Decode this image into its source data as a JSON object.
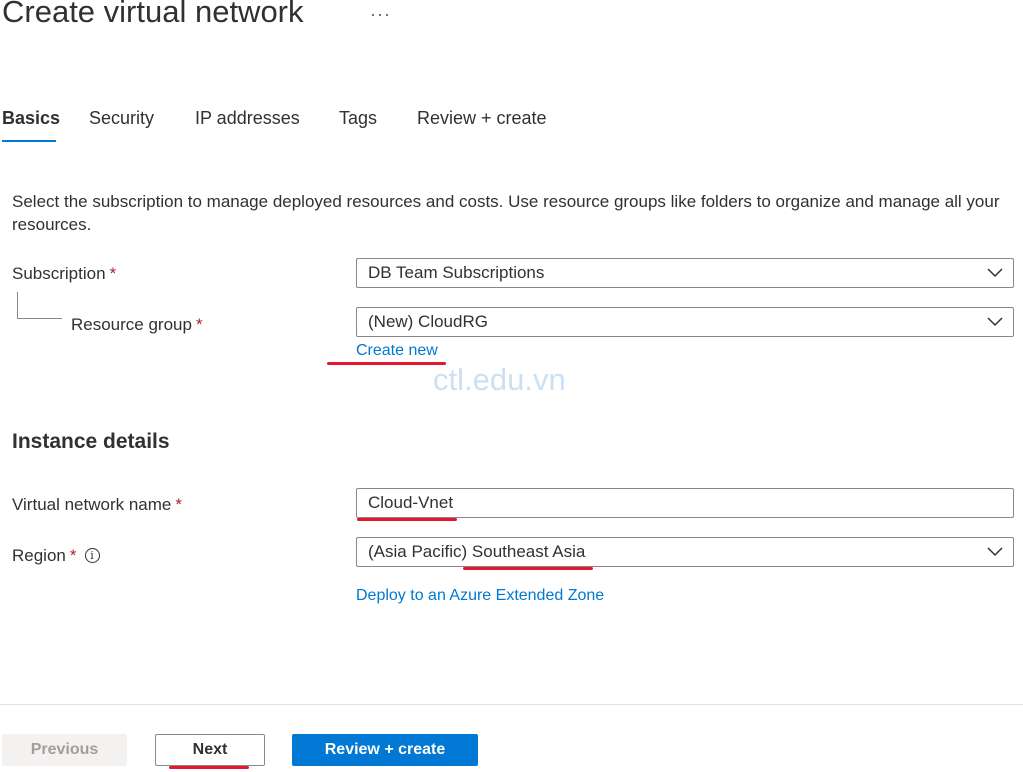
{
  "header": {
    "title": "Create virtual network",
    "more_label": "···"
  },
  "tabs": [
    {
      "label": "Basics",
      "active": true
    },
    {
      "label": "Security",
      "active": false
    },
    {
      "label": "IP addresses",
      "active": false
    },
    {
      "label": "Tags",
      "active": false
    },
    {
      "label": "Review + create",
      "active": false
    }
  ],
  "description": "Select the subscription to manage deployed resources and costs. Use resource groups like folders to organize and manage all your resources.",
  "form": {
    "required_mark": "*",
    "subscription": {
      "label": "Subscription",
      "value": "DB Team Subscriptions"
    },
    "resource_group": {
      "label": "Resource group",
      "value": "(New) CloudRG",
      "create_link": "Create new"
    },
    "instance_section": "Instance details",
    "vnet_name": {
      "label": "Virtual network name",
      "value": "Cloud-Vnet"
    },
    "region": {
      "label": "Region",
      "info_icon": "i",
      "value": "(Asia Pacific) Southeast Asia",
      "extended_zone_link": "Deploy to an Azure Extended Zone"
    }
  },
  "watermark": "ctl.edu.vn",
  "footer": {
    "previous_label": "Previous",
    "next_label": "Next",
    "review_label": "Review + create"
  },
  "icons": {
    "more": "more-horizontal-icon",
    "dropdown": "chevron-down-icon",
    "info": "info-icon"
  },
  "colors": {
    "accent": "#0078d4",
    "required": "#a4262c",
    "annotation": "#e3172e",
    "watermark": "#a9cdea"
  }
}
